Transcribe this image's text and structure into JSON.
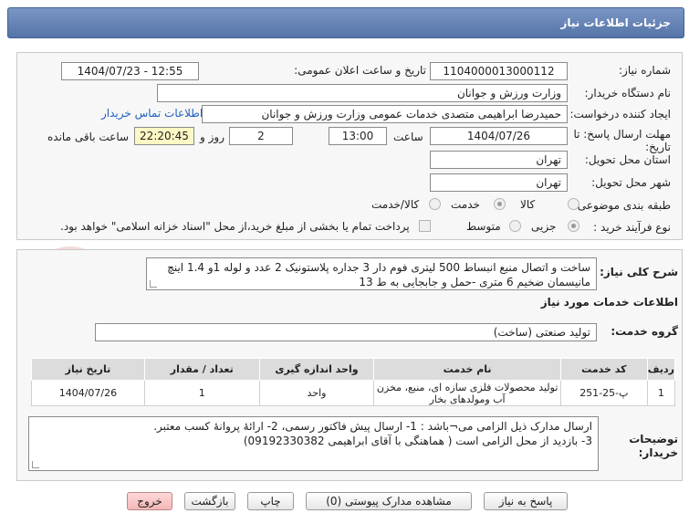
{
  "header": {
    "title": "جزئیات اطلاعات نیاز"
  },
  "form": {
    "need_number": {
      "label": "شماره نیاز:",
      "value": "1104000013000112"
    },
    "announce_date": {
      "label": "تاریخ و ساعت اعلان عمومی:",
      "value": "1404/07/23 - 12:55"
    },
    "buyer_org": {
      "label": "نام دستگاه خریدار:",
      "value": "وزارت ورزش و جوانان"
    },
    "requester": {
      "label": "ایجاد کننده درخواست:",
      "value": "حمیدرضا ابراهیمی متصدی خدمات عمومی وزارت ورزش و جوانان"
    },
    "buyer_contact_link": "اطلاعات تماس خریدار",
    "deadline": {
      "label_line1": "مهلت ارسال پاسخ: تا",
      "label_line2": "تاریخ:",
      "date": "1404/07/26",
      "time_label": "ساعت",
      "time": "13:00",
      "days": "2",
      "days_label": "روز و",
      "remaining": "22:20:45",
      "remaining_label": "ساعت باقی مانده"
    },
    "province": {
      "label": "استان محل تحویل:",
      "value": "تهران"
    },
    "city": {
      "label": "شهر محل تحویل:",
      "value": "تهران"
    },
    "category": {
      "label": "طبقه بندی موضوعی:",
      "options": [
        "کالا",
        "خدمت",
        "کالا/خدمت"
      ],
      "selected": "خدمت"
    },
    "process": {
      "label": "نوع فرآیند خرید :",
      "options": [
        "جزیی",
        "متوسط"
      ],
      "selected": "جزیی",
      "payment_note": "پرداخت تمام یا بخشی از مبلغ خرید،از محل \"اسناد خزانه اسلامی\" خواهد بود."
    }
  },
  "need": {
    "summary_label": "شرح کلی نیاز:",
    "summary": "ساخت و اتصال منبع انبساط 500 لیتری فوم دار 3 جداره پلاستونیک 2 عدد و لوله 1و 1.4 اینچ مانیسمان ضخیم 6 متری -حمل و جابجایی به ط 13",
    "services_title": "اطلاعات خدمات مورد نیاز",
    "service_group_label": "گروه خدمت:",
    "service_group": "تولید صنعتی (ساخت)"
  },
  "table": {
    "headers": [
      "ردیف",
      "کد خدمت",
      "نام خدمت",
      "واحد اندازه گیری",
      "تعداد / مقدار",
      "تاریخ نیاز"
    ],
    "rows": [
      [
        "1",
        "پ-25-251",
        "تولید محصولات فلزی سازه ای، منبع، مخزن آب ومولدهای بخار",
        "واحد",
        "1",
        "1404/07/26"
      ]
    ]
  },
  "buyer_notes": {
    "label_line1": "توضیحات",
    "label_line2": "خریدار:",
    "line1": "ارسال مدارک ذیل الزامی می¬باشد : 1- ارسال پیش فاکتور رسمی، 2- ارائۀ پروانۀ کسب معتبر.",
    "line2": "3- بازدید از محل الزامی است ( هماهنگی با آقای ابراهیمی 09192330382)"
  },
  "buttons": {
    "reply": "پاسخ به نیاز",
    "attachments": "مشاهده مدارک پیوستی (0)",
    "print": "چاپ",
    "back": "بازگشت",
    "exit": "خروج"
  },
  "watermark_text": "AriaTender.net",
  "colors": {
    "header": "#5f7db3",
    "link": "#1f5fbf",
    "time_highlight": "#fff8c4",
    "exit_button": "#f4b7b7"
  }
}
